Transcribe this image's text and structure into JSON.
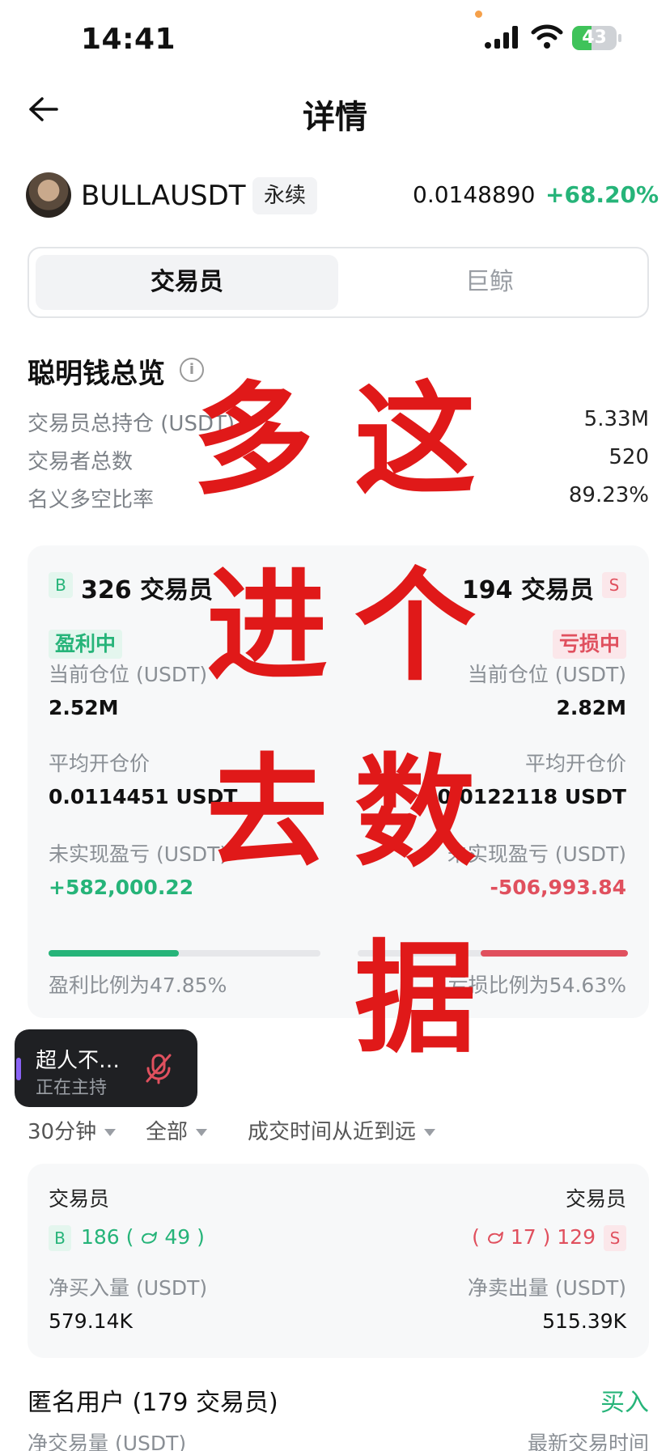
{
  "status_bar": {
    "time": "14:41",
    "battery": "43"
  },
  "header": {
    "title": "详情"
  },
  "coin": {
    "symbol": "BULLAUSDT",
    "type": "永续",
    "price": "0.0148890",
    "change": "+68.20%"
  },
  "tabs": {
    "active": "交易员",
    "inactive": "巨鲸"
  },
  "overview": {
    "title": "聪明钱总览",
    "rows": [
      {
        "label": "交易员总持仓 (USDT)",
        "value": "5.33M"
      },
      {
        "label": "交易者总数",
        "value": "520"
      },
      {
        "label": "名义多空比率",
        "value": "89.23%"
      }
    ]
  },
  "long": {
    "badge": "B",
    "count": "326 交易员",
    "status": "盈利中",
    "position_label": "当前仓位 (USDT)",
    "position": "2.52M",
    "avg_label": "平均开仓价",
    "avg": "0.0114451 USDT",
    "pnl_label": "未实现盈亏 (USDT)",
    "pnl": "+582,000.22",
    "ratio_text": "盈利比例为47.85%",
    "ratio": 0.4785
  },
  "short": {
    "badge": "S",
    "count": "194 交易员",
    "status": "亏损中",
    "position_label": "当前仓位 (USDT)",
    "position": "2.82M",
    "avg_label": "平均开仓价",
    "avg": "0.0122118 USDT",
    "pnl_label": "未实现盈亏 (USDT)",
    "pnl": "-506,993.84",
    "ratio_text": "亏损比例为54.63%",
    "ratio": 0.5463
  },
  "live": {
    "title": "超人不…",
    "subtitle": "正在主持"
  },
  "filters": {
    "interval": "30分钟",
    "scope": "全部",
    "sort": "成交时间从近到远"
  },
  "net": {
    "buy_label": "交易员",
    "sell_label": "交易员",
    "buy_badge": "B",
    "buy_count": "186",
    "buy_whales": "49",
    "sell_badge": "S",
    "sell_count": "129",
    "sell_whales": "17",
    "buy_vol_label": "净买入量 (USDT)",
    "buy_vol": "579.14K",
    "sell_vol_label": "净卖出量 (USDT)",
    "sell_vol": "515.39K"
  },
  "anon": {
    "title": "匿名用户 (179 交易员)",
    "action": "买入",
    "col_left": "净交易量 (USDT)",
    "col_right": "最新交易时间"
  },
  "overlay": {
    "chars": [
      "多",
      "这",
      "进",
      "个",
      "去",
      "数",
      "据"
    ]
  },
  "colors": {
    "up": "#26b479",
    "down": "#e0505e",
    "overlay": "#e01919"
  }
}
